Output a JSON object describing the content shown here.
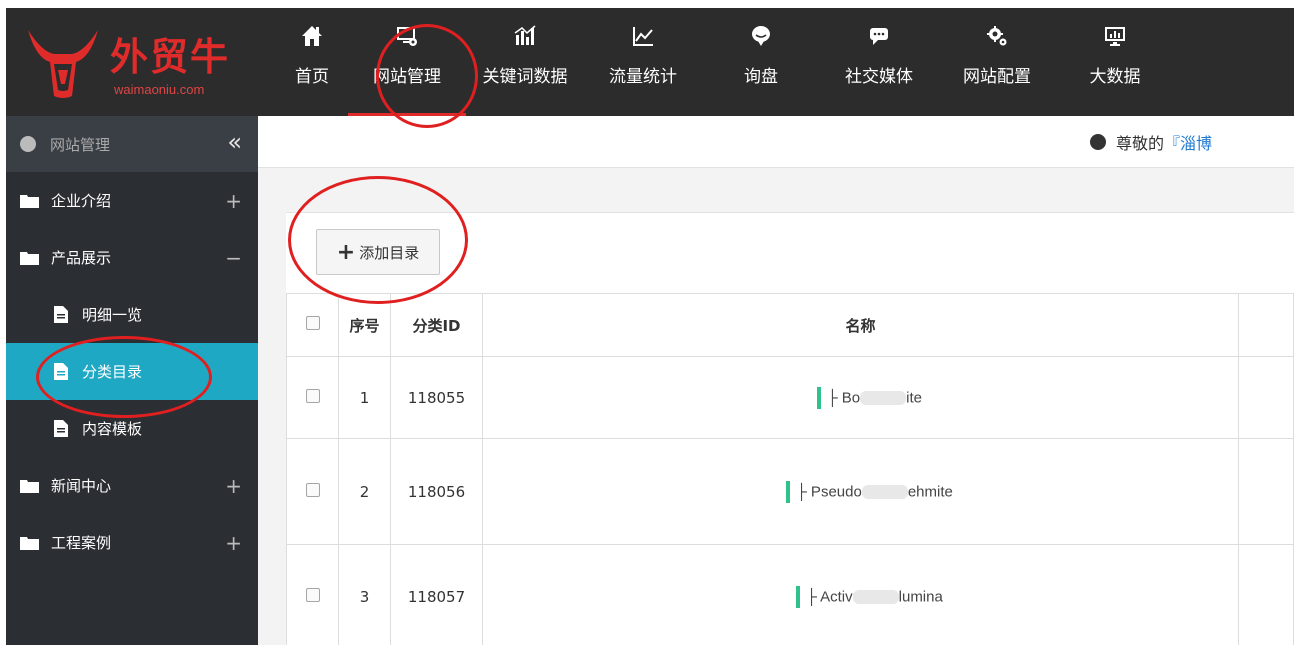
{
  "logo": {
    "title": "外贸牛",
    "subtitle": "waimaoniu.com"
  },
  "nav": [
    {
      "label": "首页",
      "icon": "home-icon"
    },
    {
      "label": "网站管理",
      "icon": "monitor-gear-icon"
    },
    {
      "label": "关键词数据",
      "icon": "bar-chart-icon"
    },
    {
      "label": "流量统计",
      "icon": "line-chart-icon"
    },
    {
      "label": "询盘",
      "icon": "chat-bubble-icon"
    },
    {
      "label": "社交媒体",
      "icon": "comment-icon"
    },
    {
      "label": "网站配置",
      "icon": "gears-icon"
    },
    {
      "label": "大数据",
      "icon": "screen-chart-icon"
    }
  ],
  "sidebar": {
    "header": "网站管理",
    "collapse": "«",
    "items": [
      {
        "label": "企业介绍",
        "toggle": "+"
      },
      {
        "label": "产品展示",
        "toggle": "−"
      },
      {
        "label": "新闻中心",
        "toggle": "+"
      },
      {
        "label": "工程案例",
        "toggle": "+"
      }
    ],
    "subitems": [
      {
        "label": "明细一览"
      },
      {
        "label": "分类目录"
      },
      {
        "label": "内容模板"
      }
    ]
  },
  "notice": {
    "prefix": "尊敬的",
    "name": "『淄博"
  },
  "toolbar": {
    "add_label": "添加目录"
  },
  "table": {
    "headers": [
      "序号",
      "分类ID",
      "名称"
    ],
    "rows": [
      {
        "index": "1",
        "id": "118055",
        "name_start": "├ Bo",
        "name_end": "ite"
      },
      {
        "index": "2",
        "id": "118056",
        "name_start": "├ Pseudo",
        "name_end": "ehmite"
      },
      {
        "index": "3",
        "id": "118057",
        "name_start": "├ Activ",
        "name_end": "lumina"
      }
    ]
  },
  "colors": {
    "accent": "#1fa8c4",
    "brand_red": "#e02b2b",
    "tree_bar": "#2fc28c"
  }
}
